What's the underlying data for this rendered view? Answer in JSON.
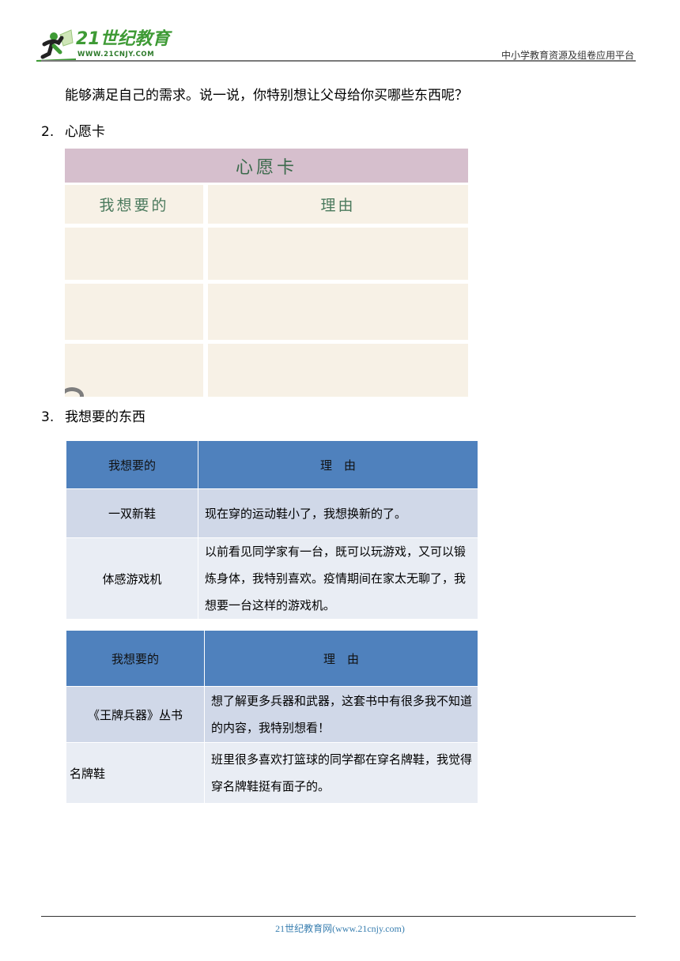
{
  "header": {
    "logo_text": "21世纪教育",
    "logo_url": "WWW.21CNJY.COM",
    "right_text": "中小学教育资源及组卷应用平台"
  },
  "intro_paragraph": "能够满足自己的需求。说一说，你特别想让父母给你买哪些东西呢？",
  "sections": [
    {
      "number": "2.",
      "title": "心愿卡"
    },
    {
      "number": "3.",
      "title": "我想要的东西"
    }
  ],
  "wish_card": {
    "title": "心愿卡",
    "col_want": "我想要的",
    "col_reason": "理由",
    "empty_rows": 3
  },
  "tables": [
    {
      "headers": [
        "我想要的",
        "理　由"
      ],
      "rows": [
        {
          "item": "一双新鞋",
          "reason": "现在穿的运动鞋小了，我想换新的了。"
        },
        {
          "item": "体感游戏机",
          "reason": "以前看见同学家有一台，既可以玩游戏，又可以锻炼身体，我特别喜欢。疫情期间在家太无聊了，我想要一台这样的游戏机。"
        }
      ]
    },
    {
      "headers": [
        "我想要的",
        "理　由"
      ],
      "rows": [
        {
          "item": "《王牌兵器》丛书",
          "reason": "想了解更多兵器和武器，这套书中有很多我不知道的内容，我特别想看！"
        },
        {
          "item": "名牌鞋",
          "reason": "班里很多喜欢打篮球的同学都在穿名牌鞋，我觉得穿名牌鞋挺有面子的。"
        }
      ]
    }
  ],
  "footer": {
    "text": "21世纪教育网(www.21cnjy.com)"
  }
}
